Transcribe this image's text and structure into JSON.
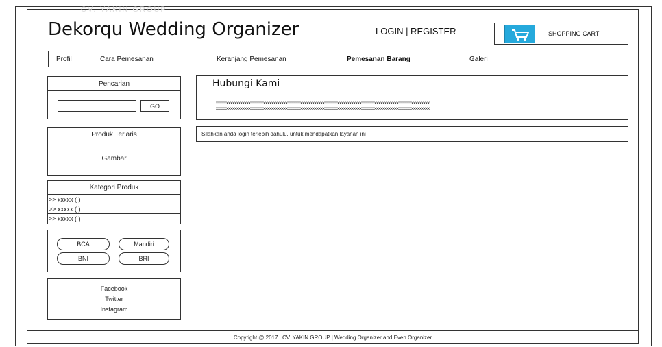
{
  "header": {
    "faded_text": "CV. YAKIN GROUP",
    "site_title": "Dekorqu Wedding Organizer",
    "auth_links": "LOGIN | REGISTER",
    "cart_label": "SHOPPING CART",
    "cart_icon": "shopping-cart-icon"
  },
  "nav": {
    "items": [
      {
        "label": "Profil"
      },
      {
        "label": "Cara Pemesanan"
      },
      {
        "label": "Keranjang Pemesanan"
      },
      {
        "label": "Pemesanan Barang"
      },
      {
        "label": "Galeri"
      }
    ],
    "active": "Pemesanan Barang"
  },
  "sidebar": {
    "search": {
      "title": "Pencarian",
      "button": "GO",
      "value": ""
    },
    "best_seller": {
      "title": "Produk Terlaris",
      "image_label": "Gambar"
    },
    "categories": {
      "title": "Kategori Produk",
      "items": [
        ">> xxxxx ( )",
        ">> xxxxx ( )",
        ">> xxxxx ( )"
      ]
    },
    "banks": [
      "BCA",
      "Mandiri",
      "BNI",
      "BRI"
    ],
    "social": [
      "Facebook",
      "Twitter",
      "Instagram"
    ]
  },
  "main": {
    "contact": {
      "title": "Hubungi Kami",
      "line1": "xxxxxxxxxxxxxxxxxxxxxxxxxxxxxxxxxxxxxxxxxxxxxxxxxxxxxxxxxxxxxxxxxxxxxxxxxxxxxxxxxxxxxxxxxxxxxxxxxxxxxxxx",
      "line2": "xxxxxxxxxxxxxxxxxxxxxxxxxxxxxxxxxxxxxxxxxxxxxxxxxxxxxxxxxxxxxxxxxxxxxxxxxxxxxxxxxxxxxxxxxxxxxxxxxxxxxxxx"
    },
    "notice": "Silahkan anda login terlebih dahulu, untuk mendapatkan layanan ini"
  },
  "footer": {
    "copyright": "Copyright @ 2017 | CV. YAKIN GROUP | Wedding Organizer and Even Organizer"
  }
}
